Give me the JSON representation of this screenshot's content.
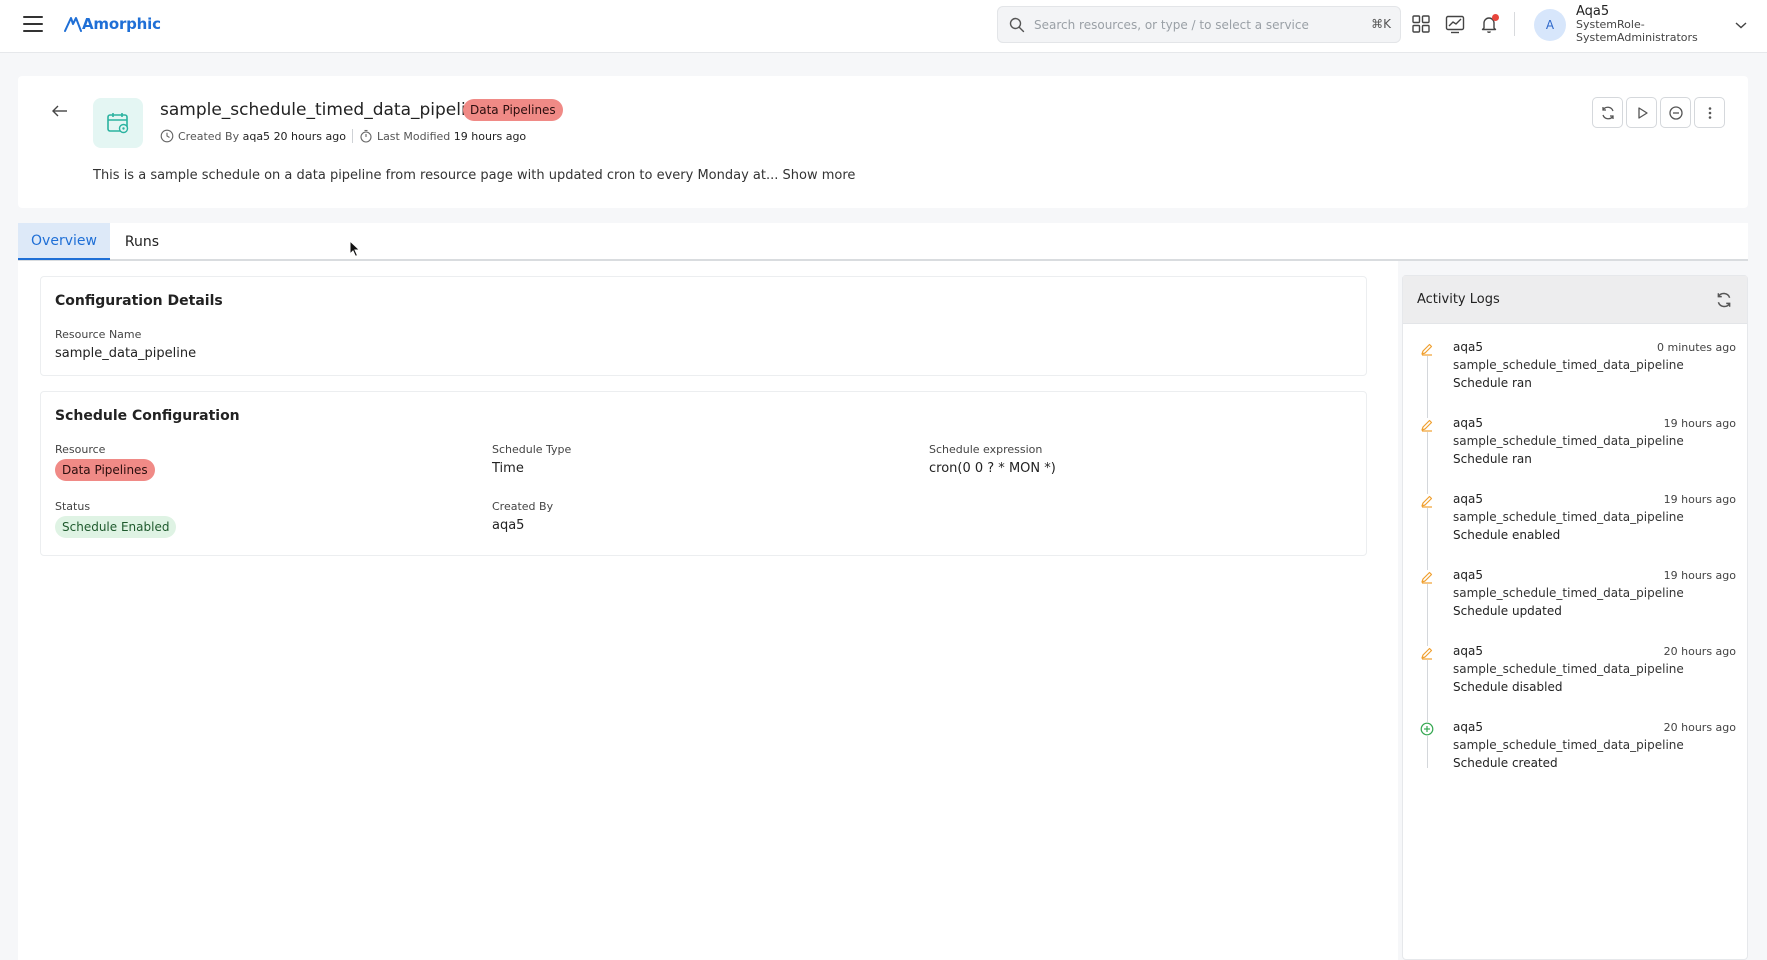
{
  "topbar": {
    "brand": "Amorphic",
    "search_placeholder": "Search resources, or type / to select a service",
    "search_shortcut": "⌘K",
    "icons": [
      "menu-icon",
      "apps-grid-icon",
      "insights-chart-icon",
      "bell-icon",
      "chevron-down-icon"
    ],
    "user": {
      "initial": "A",
      "name": "Aqa5",
      "role_line1": "SystemRole-",
      "role_line2": "SystemAdministrators"
    }
  },
  "header": {
    "title": "sample_schedule_timed_data_pipeline",
    "type_badge": "Data Pipelines",
    "created_by_label": "Created By",
    "created_by_user": "aqa5",
    "created_ago": "20 hours ago",
    "last_modified_label": "Last Modified",
    "last_modified_ago": "19 hours ago",
    "description": "This is a sample schedule on a data pipeline from resource page with updated cron to every Monday at...",
    "show_more": "Show more",
    "action_icons": [
      "refresh-icon",
      "run-play-icon",
      "disable-circle-icon",
      "more-vertical-icon"
    ]
  },
  "tabs": [
    {
      "label": "Overview",
      "active": true
    },
    {
      "label": "Runs",
      "active": false
    }
  ],
  "configuration": {
    "title": "Configuration Details",
    "resource_name_label": "Resource Name",
    "resource_name": "sample_data_pipeline"
  },
  "schedule": {
    "title": "Schedule Configuration",
    "resource_label": "Resource",
    "resource_value": "Data Pipelines",
    "schedule_type_label": "Schedule Type",
    "schedule_type_value": "Time",
    "expression_label": "Schedule expression",
    "expression_value": "cron(0 0 ? * MON *)",
    "status_label": "Status",
    "status_value": "Schedule Enabled",
    "created_by_label": "Created By",
    "created_by_value": "aqa5"
  },
  "activity": {
    "title": "Activity Logs",
    "logs": [
      {
        "user": "aqa5",
        "time": "0 minutes ago",
        "resource": "sample_schedule_timed_data_pipeline",
        "action": "Schedule ran",
        "icon": "edit-icon"
      },
      {
        "user": "aqa5",
        "time": "19 hours ago",
        "resource": "sample_schedule_timed_data_pipeline",
        "action": "Schedule ran",
        "icon": "edit-icon"
      },
      {
        "user": "aqa5",
        "time": "19 hours ago",
        "resource": "sample_schedule_timed_data_pipeline",
        "action": "Schedule enabled",
        "icon": "edit-icon"
      },
      {
        "user": "aqa5",
        "time": "19 hours ago",
        "resource": "sample_schedule_timed_data_pipeline",
        "action": "Schedule updated",
        "icon": "edit-icon"
      },
      {
        "user": "aqa5",
        "time": "20 hours ago",
        "resource": "sample_schedule_timed_data_pipeline",
        "action": "Schedule disabled",
        "icon": "edit-icon"
      },
      {
        "user": "aqa5",
        "time": "20 hours ago",
        "resource": "sample_schedule_timed_data_pipeline",
        "action": "Schedule created",
        "icon": "plus-circle-icon"
      }
    ]
  },
  "colors": {
    "accent": "#1f6fd6",
    "badge_red": "#f08a86",
    "badge_green": "#dff3e4",
    "log_edit_icon": "#f0a030",
    "log_create_icon": "#36a852"
  }
}
